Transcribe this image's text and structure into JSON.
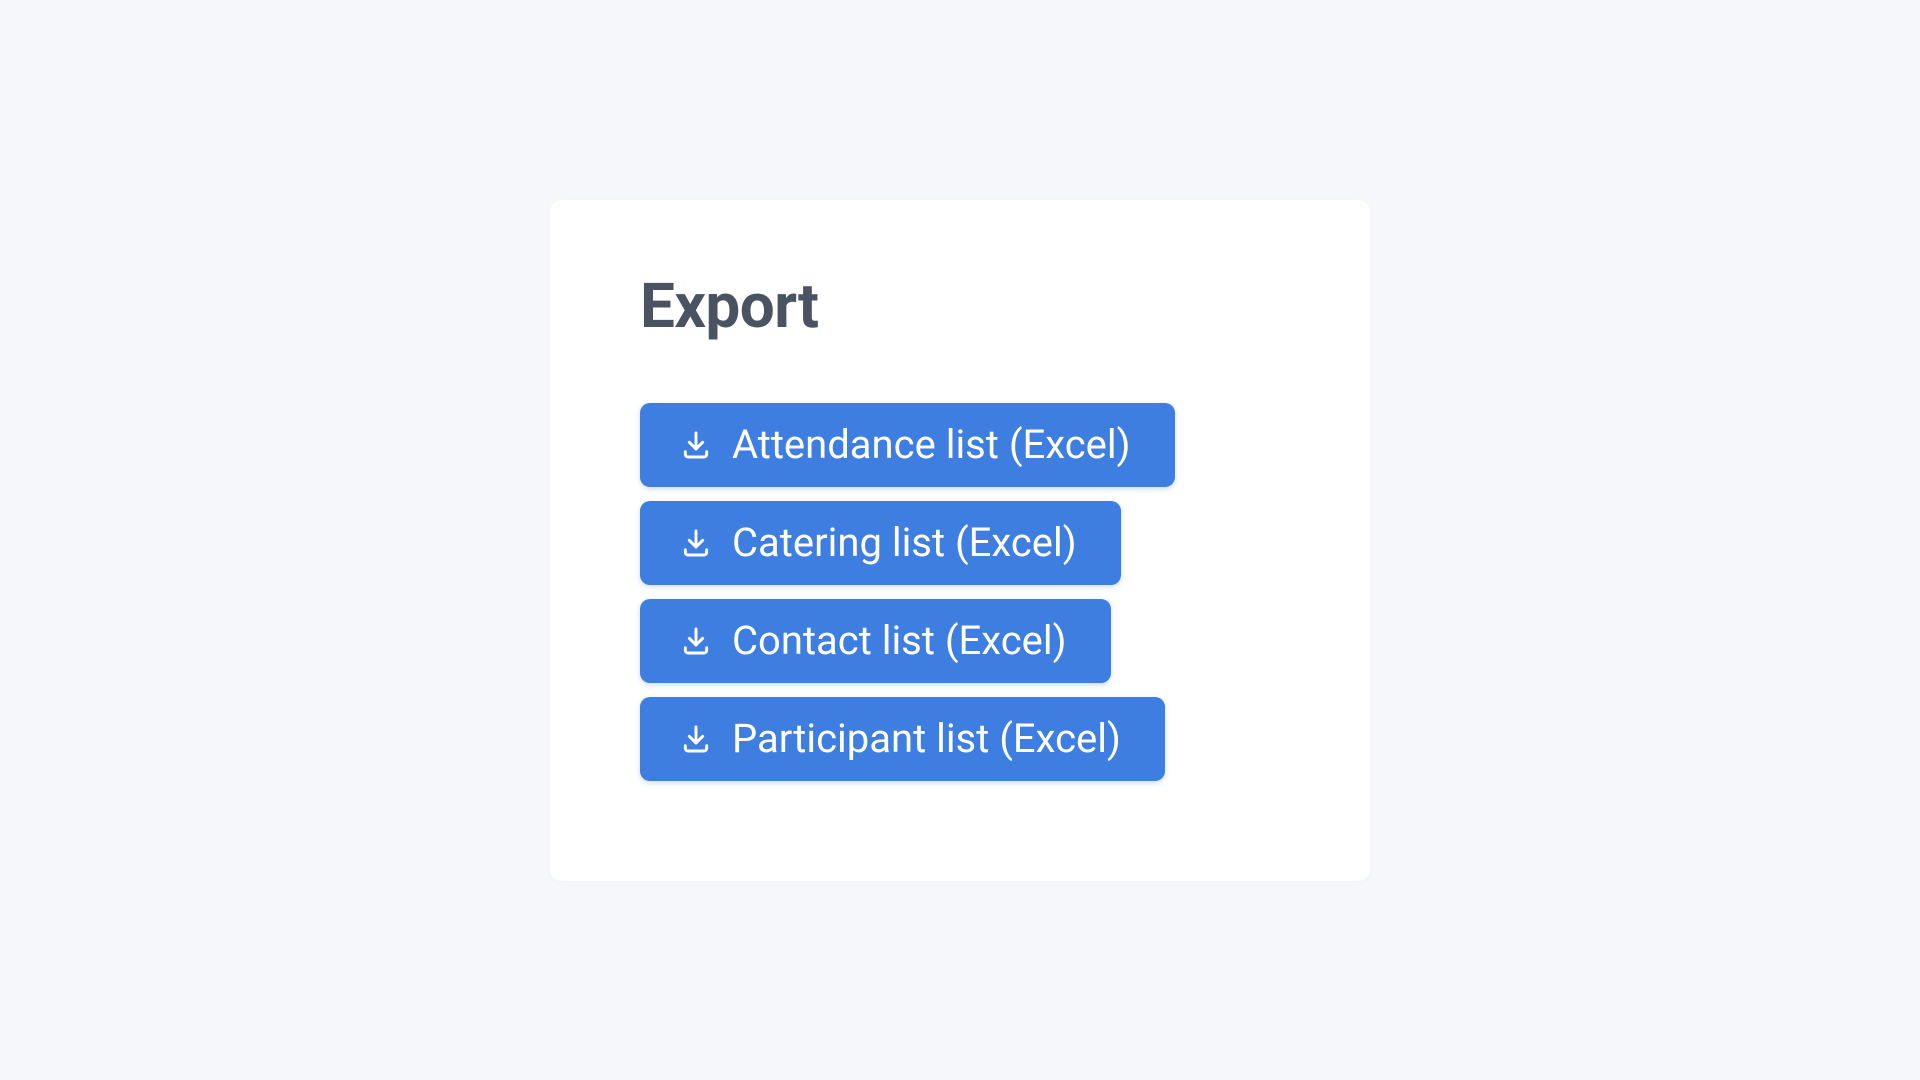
{
  "heading": "Export",
  "buttons": [
    {
      "label": "Attendance list (Excel)"
    },
    {
      "label": "Catering list (Excel)"
    },
    {
      "label": "Contact list (Excel)"
    },
    {
      "label": "Participant list (Excel)"
    }
  ]
}
